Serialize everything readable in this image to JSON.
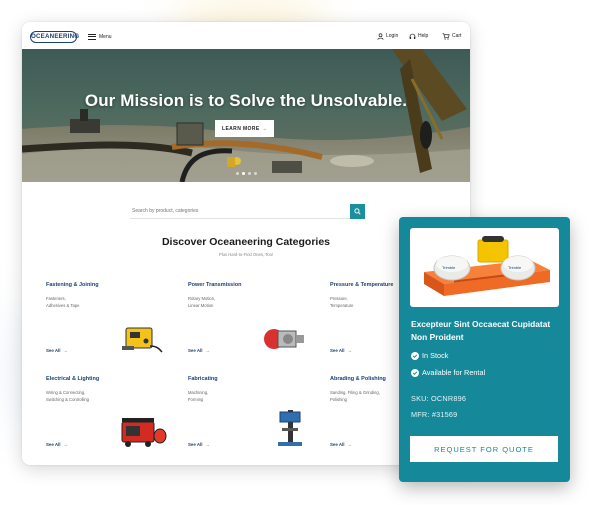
{
  "header": {
    "logo_text": "OCEANEERING",
    "menu_label": "Menu",
    "login_label": "Login",
    "help_label": "Help",
    "cart_label": "Cart"
  },
  "hero": {
    "title": "Our Mission is to Solve the Unsolvable.",
    "cta_label": "LEARN MORE",
    "cta_arrow": "→",
    "carousel_slides": 4,
    "active_slide": 2
  },
  "search": {
    "placeholder": "Search by product, categories"
  },
  "categories": {
    "title": "Discover Oceaneering Categories",
    "subtitle": "Plus Hard-to-Find Ones, Too!",
    "see_all_label": "See All",
    "see_all_arrow": "→",
    "items": [
      {
        "name": "Fastening & Joining",
        "desc": "Fasteners,\nAdhesives & Tape",
        "icon": "welder-icon"
      },
      {
        "name": "Power Transmission",
        "desc": "Rotary Motion,\nLinear Motion",
        "icon": "pump-icon"
      },
      {
        "name": "Pressure & Temperature",
        "desc": "Pressure,\nTemperature",
        "icon": "gauge-icon"
      },
      {
        "name": "Electrical & Lighting",
        "desc": "Wiring & Connecting,\nSwitching & Controlling",
        "icon": "generator-icon"
      },
      {
        "name": "Fabricating",
        "desc": "Machining,\nForming",
        "icon": "drill-press-icon"
      },
      {
        "name": "Abrading & Polishing",
        "desc": "Sanding, Filing & Grinding,\nPolishing",
        "icon": "grinder-icon"
      }
    ]
  },
  "product": {
    "title": "Excepteur Sint Occaecat Cupidatat Non Proident",
    "status_1": "In Stock",
    "status_2": "Available for Rental",
    "sku": "SKU: OCNR896",
    "mfr": "MFR: #31569",
    "cta_label": "REQUEST FOR QUOTE",
    "image_brand_text": "Trimble",
    "image_icon": "gnss-receiver-kit-icon"
  },
  "colors": {
    "brand_navy": "#1d3f73",
    "teal": "#15899a",
    "teal_button": "#1a8fa0",
    "product_orange": "#f06a24",
    "product_yellow": "#f5c400"
  }
}
